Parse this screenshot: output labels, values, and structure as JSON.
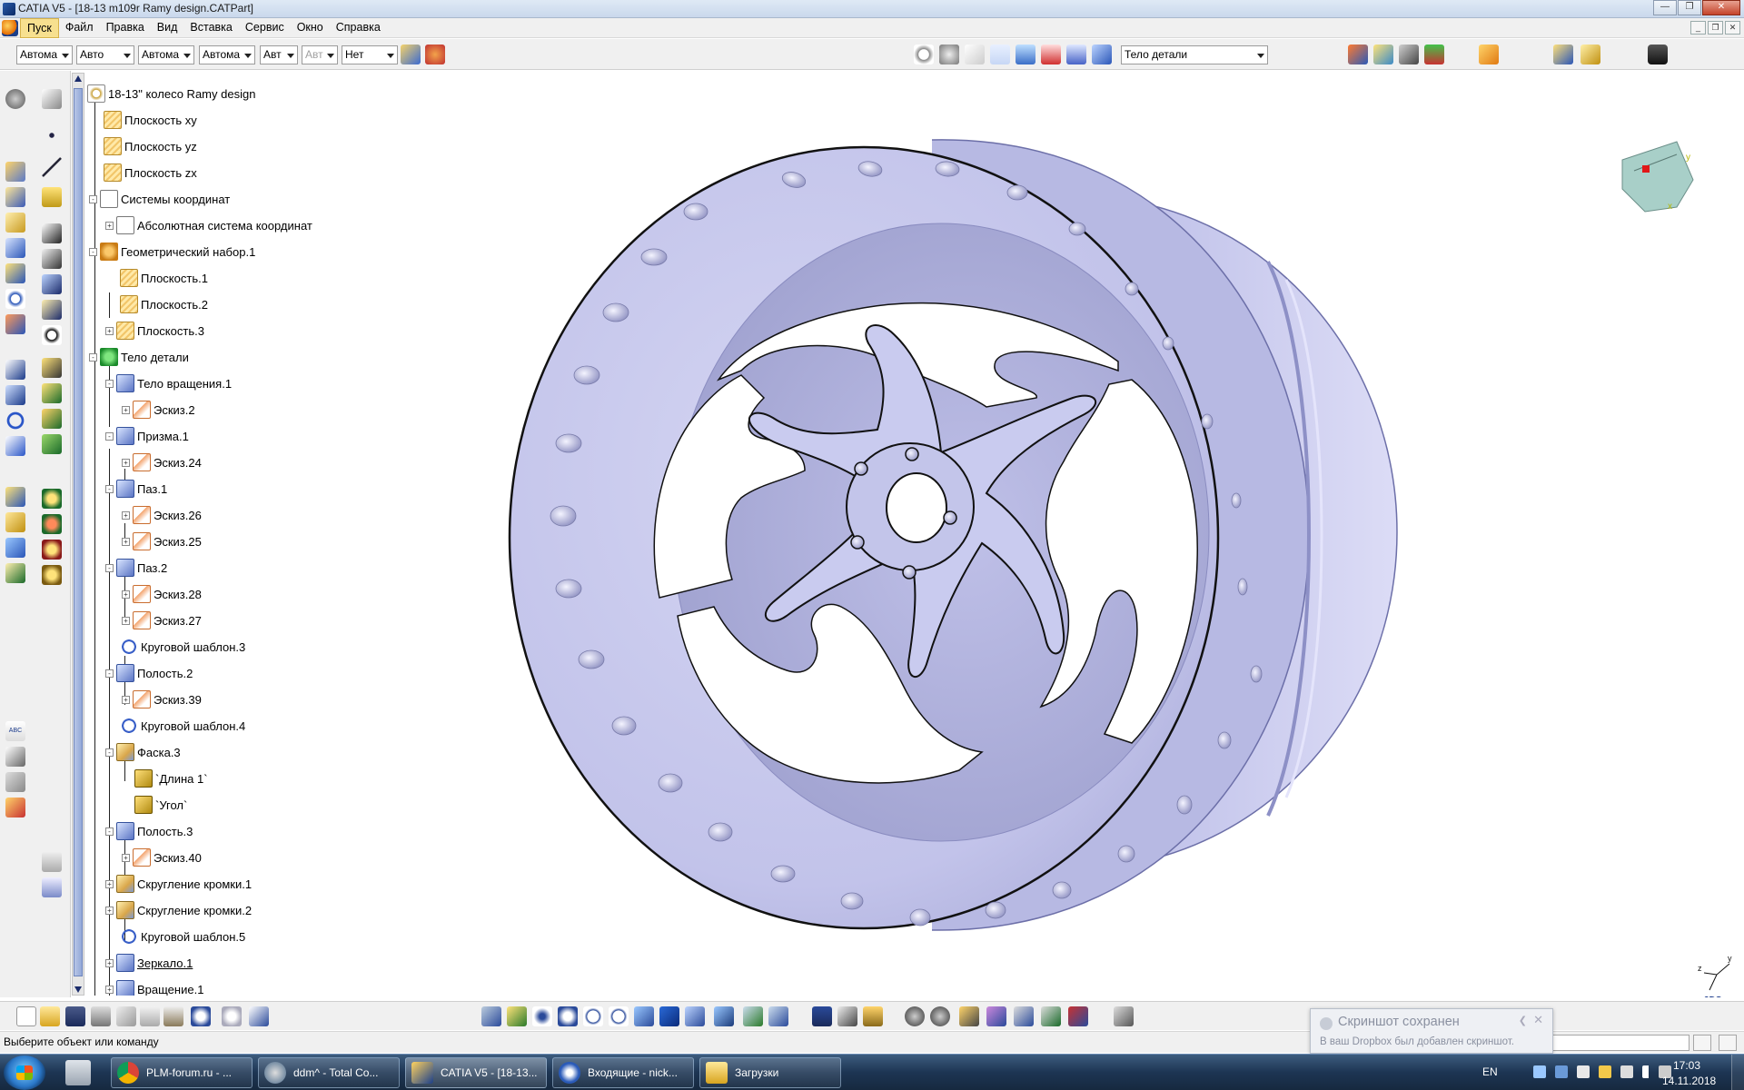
{
  "window": {
    "title": "CATIA V5 - [18-13 m109r Ramy design.CATPart]"
  },
  "menu": [
    "Пуск",
    "Файл",
    "Правка",
    "Вид",
    "Вставка",
    "Сервис",
    "Окно",
    "Справка"
  ],
  "toolbar": {
    "combo1": "Автома",
    "combo2": "Авто",
    "combo3": "Автома",
    "combo4": "Автома",
    "combo5": "Авт",
    "combo6": "Авт",
    "combo7": "Нет",
    "work_object": "Тело детали",
    "work_object_icon": "part-body-icon"
  },
  "tree": {
    "root": "18-13\" колесо Ramy design",
    "items": [
      {
        "label": "Плоскость xy",
        "icon": "plane-icon"
      },
      {
        "label": "Плоскость yz",
        "icon": "plane-icon"
      },
      {
        "label": "Плоскость zx",
        "icon": "plane-icon"
      },
      {
        "label": "Системы координат",
        "icon": "axis-system-icon"
      },
      {
        "label": "Абсолютная система координат",
        "icon": "axis-system-icon"
      },
      {
        "label": "Геометрический набор.1",
        "icon": "geometrical-set-icon"
      },
      {
        "label": "Плоскость.1",
        "icon": "plane-icon"
      },
      {
        "label": "Плоскость.2",
        "icon": "plane-icon"
      },
      {
        "label": "Плоскость.3",
        "icon": "plane-icon"
      },
      {
        "label": "Тело детали",
        "icon": "part-body-icon"
      },
      {
        "label": "Тело вращения.1",
        "icon": "shaft-icon"
      },
      {
        "label": "Эскиз.2",
        "icon": "sketch-icon"
      },
      {
        "label": "Призма.1",
        "icon": "pad-icon"
      },
      {
        "label": "Эскиз.24",
        "icon": "sketch-icon"
      },
      {
        "label": "Паз.1",
        "icon": "slot-icon"
      },
      {
        "label": "Эскиз.26",
        "icon": "sketch-icon"
      },
      {
        "label": "Эскиз.25",
        "icon": "sketch-icon"
      },
      {
        "label": "Паз.2",
        "icon": "slot-icon"
      },
      {
        "label": "Эскиз.28",
        "icon": "sketch-icon"
      },
      {
        "label": "Эскиз.27",
        "icon": "sketch-icon"
      },
      {
        "label": "Круговой шаблон.3",
        "icon": "circular-pattern-icon"
      },
      {
        "label": "Полость.2",
        "icon": "pocket-icon"
      },
      {
        "label": "Эскиз.39",
        "icon": "sketch-icon"
      },
      {
        "label": "Круговой шаблон.4",
        "icon": "circular-pattern-icon"
      },
      {
        "label": "Фаска.3",
        "icon": "chamfer-icon"
      },
      {
        "label": "`Длина 1`",
        "icon": "parameter-icon"
      },
      {
        "label": "`Угол`",
        "icon": "parameter-icon"
      },
      {
        "label": "Полость.3",
        "icon": "pocket-icon"
      },
      {
        "label": "Эскиз.40",
        "icon": "sketch-icon"
      },
      {
        "label": "Скругление кромки.1",
        "icon": "edge-fillet-icon"
      },
      {
        "label": "Скругление кромки.2",
        "icon": "edge-fillet-icon"
      },
      {
        "label": "Круговой шаблон.5",
        "icon": "circular-pattern-icon"
      },
      {
        "label": "Зеркало.1",
        "icon": "mirror-icon"
      },
      {
        "label": "Вращение.1",
        "icon": "rotate-icon"
      }
    ]
  },
  "compass": {
    "axis_x": "x",
    "axis_y": "y",
    "axis_z": "z"
  },
  "statusbar": {
    "message": "Выберите объект или команду"
  },
  "toast": {
    "title": "Скриншот сохранен",
    "text": "В ваш Dropbox был добавлен скриншот."
  },
  "taskbar": {
    "tasks": [
      {
        "label": "PLM-forum.ru - ...",
        "icon": "chrome-icon"
      },
      {
        "label": "ddm^ - Total Co...",
        "icon": "total-commander-icon"
      },
      {
        "label": "CATIA V5 - [18-13...",
        "icon": "catia-icon"
      },
      {
        "label": "Входящие - nick...",
        "icon": "thunderbird-icon"
      },
      {
        "label": "Загрузки",
        "icon": "folder-icon"
      }
    ],
    "language": "EN",
    "time": "17:03",
    "date": "14.11.2018"
  },
  "colors": {
    "wheel_face": "#c7c8ec",
    "wheel_shadow": "#9fa1cf",
    "menu_active": "#f7e08f",
    "taskbar": "#1d3553"
  }
}
